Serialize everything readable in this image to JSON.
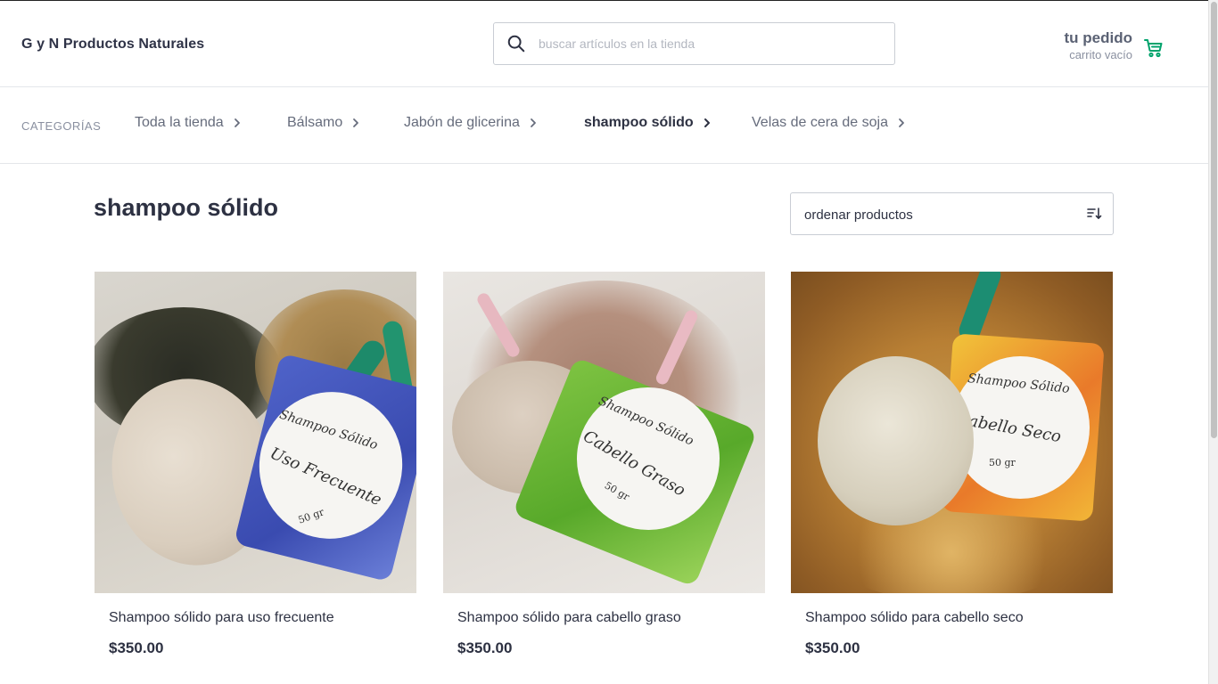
{
  "header": {
    "brand": "G y N Productos Naturales",
    "search_placeholder": "buscar artículos en la tienda",
    "cart_title": "tu pedido",
    "cart_status": "carrito vacío"
  },
  "nav": {
    "label": "CATEGORÍAS",
    "items": [
      {
        "label": "Toda la tienda",
        "active": false
      },
      {
        "label": "Bálsamo",
        "active": false
      },
      {
        "label": "Jabón de glicerina",
        "active": false
      },
      {
        "label": "shampoo sólido",
        "active": true
      },
      {
        "label": "Velas de cera de soja",
        "active": false
      }
    ]
  },
  "main": {
    "title": "shampoo sólido",
    "sort_label": "ordenar productos"
  },
  "products": [
    {
      "name": "Shampoo sólido para uso frecuente",
      "price": "$350.00",
      "label_top": "Shampoo Sólido",
      "label_script": "Uso Frecuente",
      "label_weight": "50 gr"
    },
    {
      "name": "Shampoo sólido para cabello graso",
      "price": "$350.00",
      "label_top": "Shampoo Sólido",
      "label_script": "Cabello Graso",
      "label_weight": "50 gr"
    },
    {
      "name": "Shampoo sólido para cabello seco",
      "price": "$350.00",
      "label_top": "Shampoo Sólido",
      "label_script": "Cabello Seco",
      "label_weight": "50 gr"
    }
  ],
  "colors": {
    "accent": "#00a36c",
    "text": "#2d3142",
    "muted": "#8a90a0",
    "border": "#c9cdd4"
  },
  "icons": {
    "search": "search-icon",
    "cart": "cart-icon",
    "chevron": "chevron-right-icon",
    "sort": "sort-icon"
  }
}
